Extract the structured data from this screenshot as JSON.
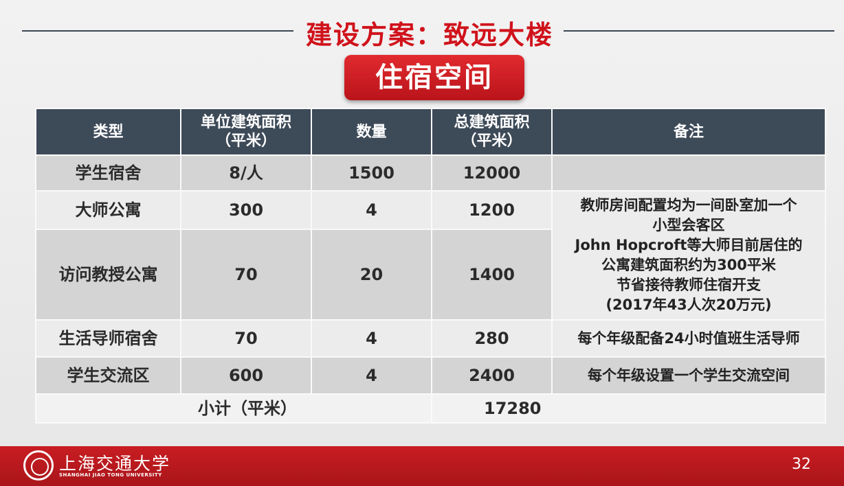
{
  "title": "建设方案：致远大楼",
  "section": "住宿空间",
  "table": {
    "headers": [
      "类型",
      "单位建筑面积\n（平米）",
      "数量",
      "总建筑面积\n（平米）",
      "备注"
    ],
    "rows": [
      {
        "type": "学生宿舍",
        "unit_area": "8/人",
        "count": "1500",
        "total": "12000"
      },
      {
        "type": "大师公寓",
        "unit_area": "300",
        "count": "4",
        "total": "1200"
      },
      {
        "type": "访问教授公寓",
        "unit_area": "70",
        "count": "20",
        "total": "1400"
      },
      {
        "type": "生活导师宿舍",
        "unit_area": "70",
        "count": "4",
        "total": "280",
        "remark": "每个年级配备24小时值班生活导师"
      },
      {
        "type": "学生交流区",
        "unit_area": "600",
        "count": "4",
        "total": "2400",
        "remark": "每个年级设置一个学生交流空间"
      }
    ],
    "merged_remark_lines": [
      "教师房间配置均为一间卧室加一个",
      "小型会客区",
      "John Hopcroft等大师目前居住的",
      "公寓建筑面积约为300平米",
      "节省接待教师住宿开支",
      "(2017年43人次20万元)"
    ],
    "subtotal_label": "小计（平米）",
    "subtotal_value": "17280"
  },
  "footer": {
    "logo_cn": "上海交通大学",
    "logo_en": "SHANGHAI JIAO TONG UNIVERSITY",
    "page_number": "32"
  },
  "colors": {
    "title_red": "#d0121b",
    "header_bg": "#3d4a58",
    "footer_red": "#c81d22"
  }
}
